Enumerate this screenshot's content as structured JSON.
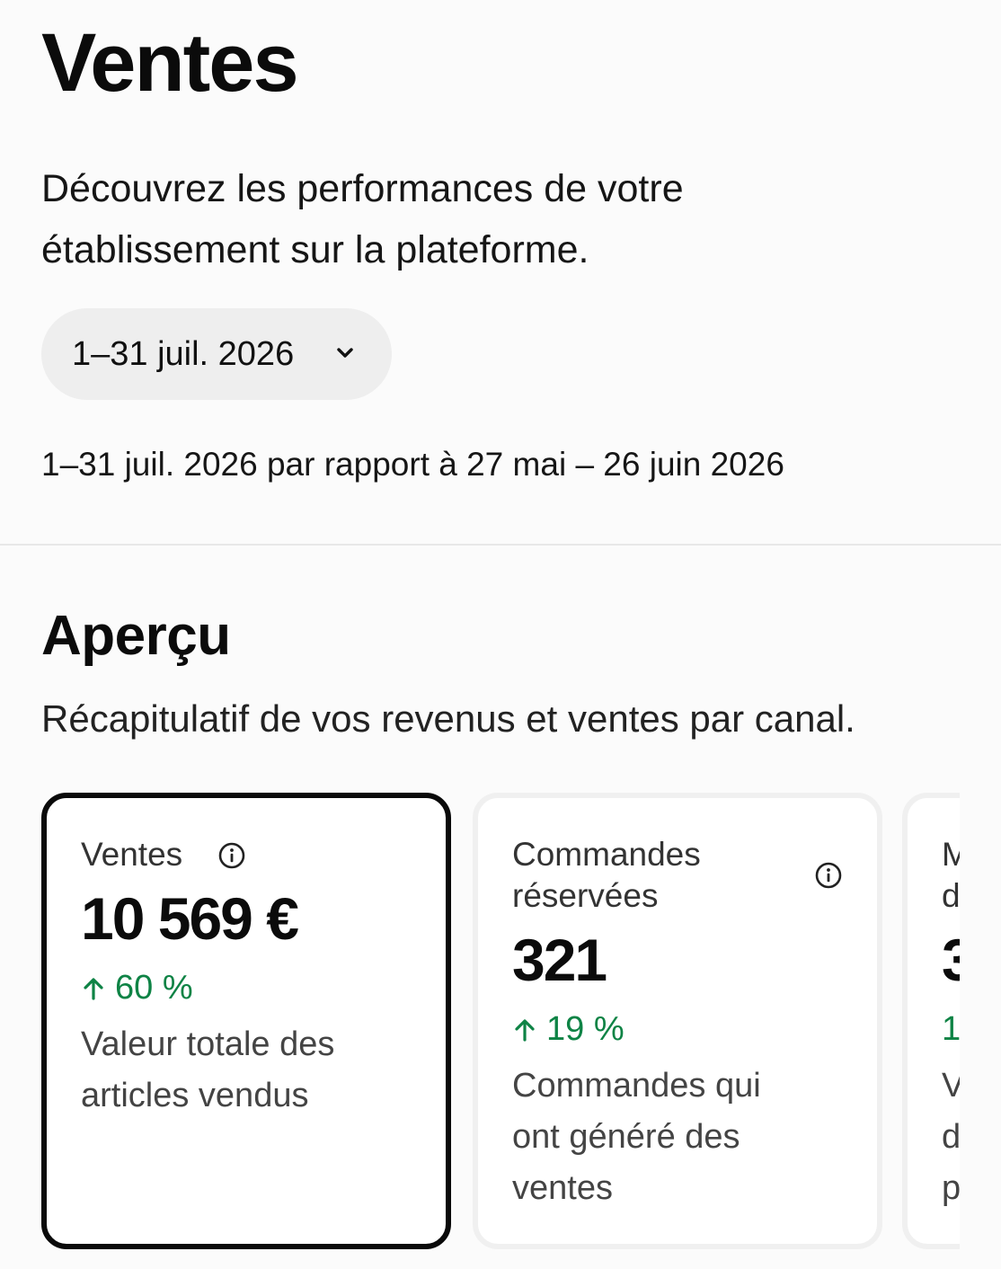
{
  "header": {
    "title": "Ventes",
    "description": "Découvrez les performances de votre établissement sur la plateforme."
  },
  "date_filter": {
    "selected": "1–31 juil. 2026",
    "comparison": "1–31 juil. 2026 par rapport à 27 mai – 26 juin 2026"
  },
  "overview": {
    "title": "Aperçu",
    "description": "Récapitulatif de vos revenus et ventes par canal.",
    "cards": [
      {
        "label": "Ventes",
        "value": "10 569 €",
        "change": "60 %",
        "change_direction": "up",
        "description": "Valeur totale des articles vendus",
        "selected": true
      },
      {
        "label_line1": "Commandes",
        "label_line2": "réservées",
        "value": "321",
        "change": "19 %",
        "change_direction": "up",
        "description": "Commandes qui ont généré des ventes",
        "selected": false
      },
      {
        "label_line1": "M",
        "label_line2": "d",
        "value": "3",
        "change": "1",
        "change_direction": "up",
        "desc_line1": "V",
        "desc_line2": "d",
        "desc_line3": "p",
        "selected": false
      }
    ]
  },
  "colors": {
    "positive_change": "#0e8345",
    "selected_border": "#0a0a0a",
    "card_border": "#f0f0f0",
    "pill_background": "#eeeeee"
  },
  "icons": {
    "chevron": "chevron-down-icon",
    "info": "info-icon",
    "trend_up": "arrow-up-icon"
  }
}
